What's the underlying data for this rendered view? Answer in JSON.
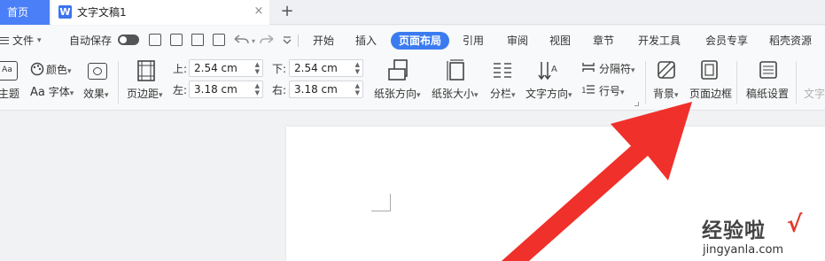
{
  "tabs": {
    "home_label": "首页",
    "doc_icon": "W",
    "doc_title": "文字文稿1",
    "close_glyph": "×",
    "add_glyph": "+"
  },
  "menu": {
    "file_label": "文件",
    "autosave_label": "自动保存",
    "tabs": [
      "开始",
      "插入",
      "页面布局",
      "引用",
      "审阅",
      "视图",
      "章节",
      "开发工具",
      "会员专享",
      "稻壳资源"
    ],
    "active_tab": "页面布局"
  },
  "ribbon": {
    "theme_label": "主题",
    "color_label": "颜色",
    "font_label": "字体",
    "font_prefix": "Aa",
    "effect_label": "效果",
    "margin_label": "页边距",
    "top_label": "上:",
    "top_value": "2.54 cm",
    "bottom_label": "下:",
    "bottom_value": "2.54 cm",
    "left_label": "左:",
    "left_value": "3.18 cm",
    "right_label": "右:",
    "right_value": "3.18 cm",
    "orientation_label": "纸张方向",
    "size_label": "纸张大小",
    "columns_label": "分栏",
    "text_direction_label": "文字方向",
    "separator_label": "分隔符",
    "line_number_label": "行号",
    "background_label": "背景",
    "page_border_label": "页面边框",
    "manuscript_label": "稿纸设置",
    "text_wrap_label": "文字"
  },
  "watermark": {
    "cn": "经验啦",
    "check": "√",
    "url": "jingyanla.com"
  },
  "colors": {
    "accent": "#3b7bf0",
    "arrow": "#f0302a",
    "home_tab": "#4a7ff7"
  }
}
